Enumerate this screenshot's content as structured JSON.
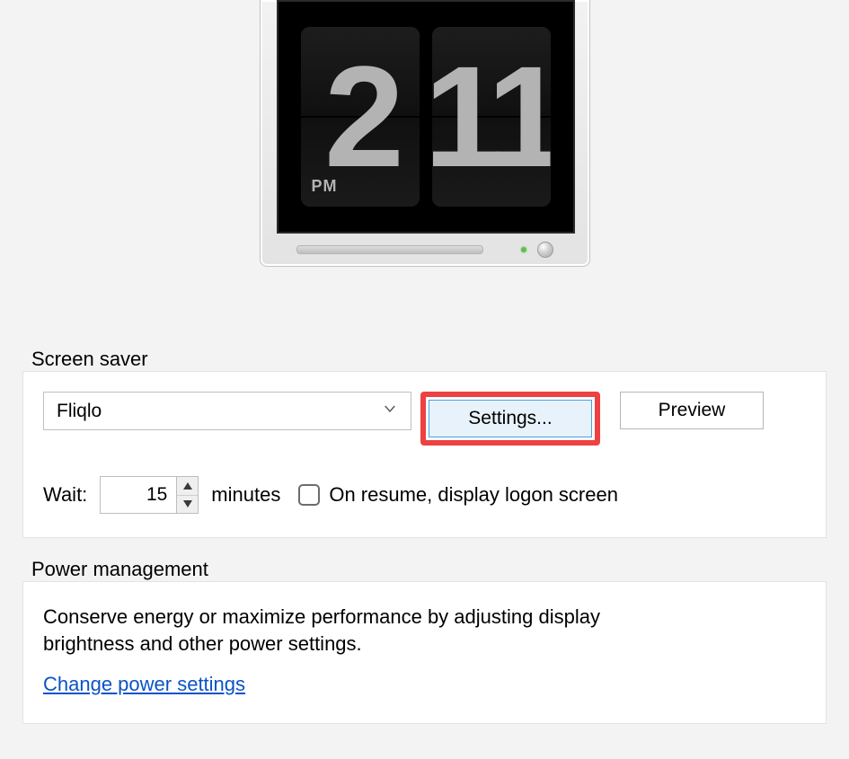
{
  "preview": {
    "hour": "2",
    "minute": "11",
    "ampm": "PM"
  },
  "screensaver": {
    "legend": "Screen saver",
    "selected": "Fliqlo",
    "settings_label": "Settings...",
    "preview_label": "Preview",
    "wait_label": "Wait:",
    "wait_value": "15",
    "minutes_label": "minutes",
    "resume_label": "On resume, display logon screen"
  },
  "power": {
    "legend": "Power management",
    "text": "Conserve energy or maximize performance by adjusting display brightness and other power settings.",
    "link": "Change power settings"
  }
}
